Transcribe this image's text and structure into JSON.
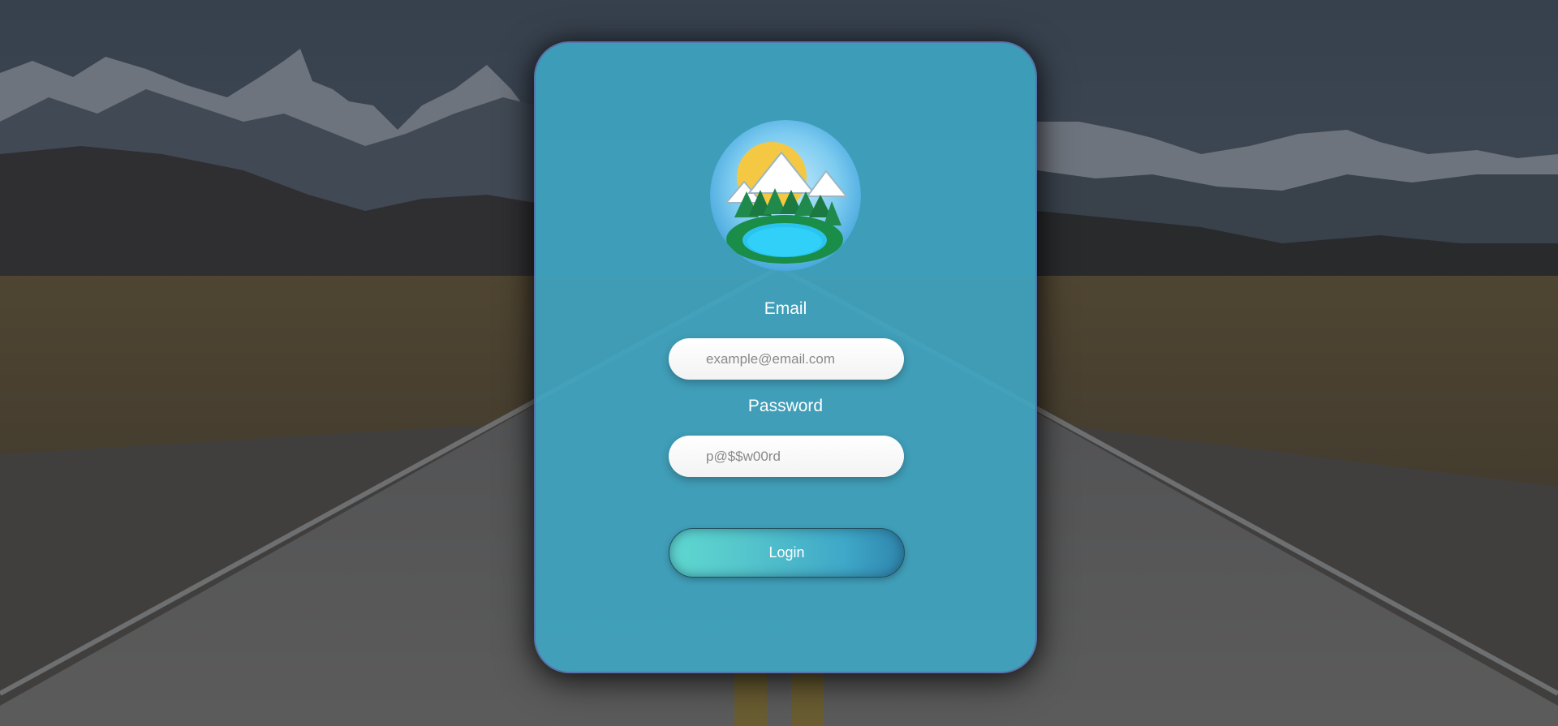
{
  "login_form": {
    "email_label": "Email",
    "email_placeholder": "example@email.com",
    "password_label": "Password",
    "password_placeholder": "p@$$w00rd",
    "login_button_label": "Login"
  },
  "icons": {
    "logo": "mountain-lake-logo-icon"
  },
  "colors": {
    "card": "#3ea6c3",
    "button_start": "#5fd8d0",
    "button_end": "#2f86ae",
    "label_text": "#ffffff"
  }
}
